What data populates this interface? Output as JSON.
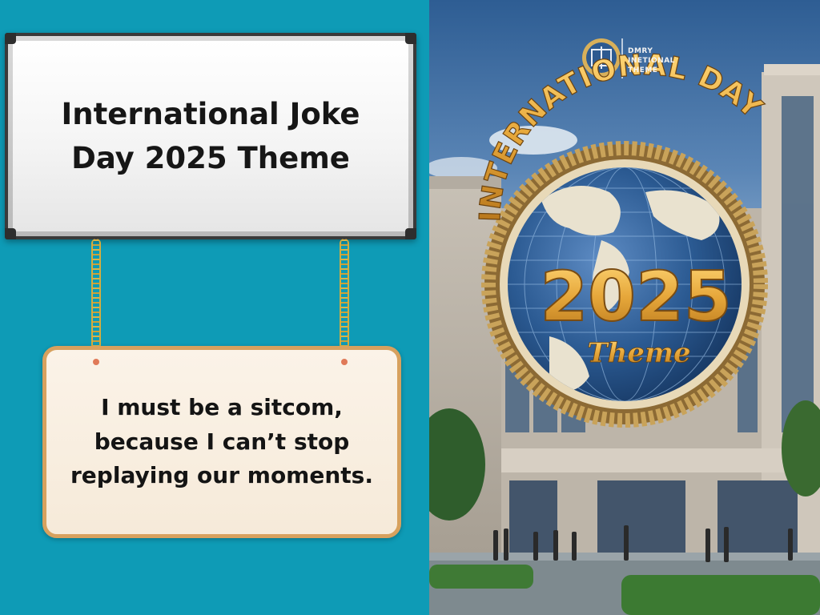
{
  "whiteboard": {
    "title": "International Joke Day 2025 Theme"
  },
  "sign": {
    "joke": "I must be a sitcom, because I can’t stop replaying our moments."
  },
  "poster": {
    "emblem_lines": [
      "DMRY",
      "INETIONAL",
      "THEME"
    ],
    "arc_text": "INTERNATIONAL DAY",
    "year": "2025",
    "subtitle": "Theme"
  },
  "colors": {
    "left_background": "#0e9bb6",
    "gold": "#e6a73a",
    "globe_blue": "#2b5a92"
  },
  "icons": [
    "globe-icon",
    "emblem-icon",
    "chain-icon"
  ]
}
